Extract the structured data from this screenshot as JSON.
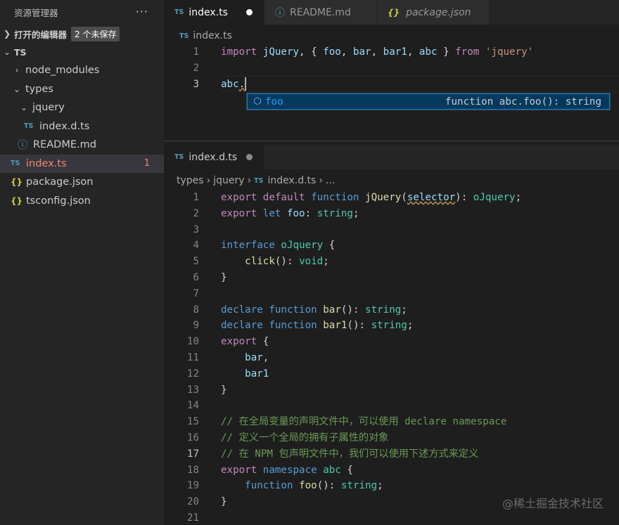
{
  "sidebar": {
    "title": "资源管理器",
    "more": "···",
    "open_editors": {
      "label": "打开的编辑器",
      "badge": "2 个未保存"
    },
    "root": "TS",
    "tree": [
      {
        "name": "node_modules"
      },
      {
        "name": "types"
      },
      {
        "name": "jquery"
      },
      {
        "name": "index.d.ts"
      },
      {
        "name": "README.md"
      },
      {
        "name": "index.ts",
        "errors": "1"
      },
      {
        "name": "package.json"
      },
      {
        "name": "tsconfig.json"
      }
    ]
  },
  "top_group": {
    "tabs": [
      {
        "icon": "TS",
        "label": "index.ts"
      },
      {
        "icon": "ⓘ",
        "label": "README.md"
      },
      {
        "icon": "{}",
        "label": "package.json"
      }
    ],
    "breadcrumb": {
      "icon": "TS",
      "file": "index.ts"
    },
    "lines": [
      "1",
      "2",
      "3"
    ],
    "suggest": {
      "icon": "cube-icon",
      "label": "foo",
      "detail": "function abc.foo(): string"
    }
  },
  "bottom_group": {
    "tab": {
      "icon": "TS",
      "label": "index.d.ts"
    },
    "breadcrumb": {
      "p1": "types",
      "p2": "jquery",
      "icon": "TS",
      "file": "index.d.ts",
      "rest": "..."
    },
    "lines": [
      "1",
      "2",
      "3",
      "4",
      "5",
      "6",
      "7",
      "8",
      "9",
      "10",
      "11",
      "12",
      "13",
      "14",
      "15",
      "16",
      "17",
      "18",
      "19",
      "20",
      "21"
    ]
  },
  "watermark": "@稀土掘金技术社区",
  "colors": {
    "keyword": "#569cd6",
    "control": "#c586c0",
    "variable": "#9cdcfe",
    "function": "#dcdcaa",
    "type": "#4ec9b0",
    "string": "#ce9178",
    "comment": "#6a9955",
    "error": "#f48771",
    "selection": "#04395e"
  }
}
